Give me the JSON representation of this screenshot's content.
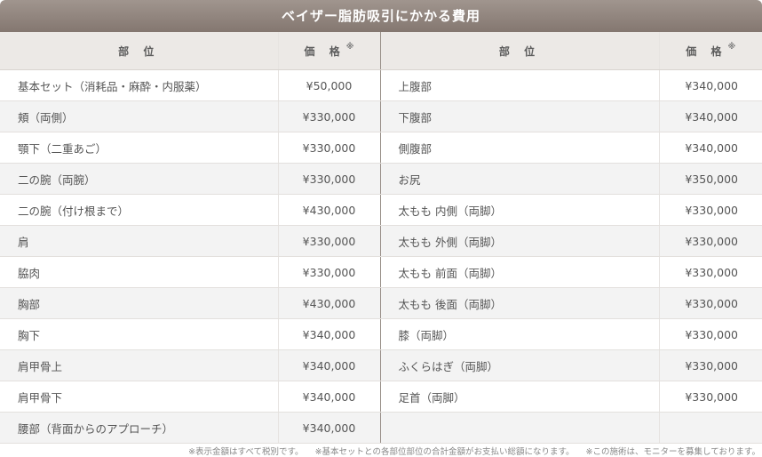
{
  "title": "ベイザー脂肪吸引にかかる費用",
  "headers": {
    "part": "部 位",
    "price": "価 格",
    "price_mark": "※"
  },
  "rows": [
    {
      "left_part": "基本セット（消耗品・麻酔・内服薬）",
      "left_price": "¥50,000",
      "right_part": "上腹部",
      "right_price": "¥340,000"
    },
    {
      "left_part": "頬（両側）",
      "left_price": "¥330,000",
      "right_part": "下腹部",
      "right_price": "¥340,000"
    },
    {
      "left_part": "顎下（二重あご）",
      "left_price": "¥330,000",
      "right_part": "側腹部",
      "right_price": "¥340,000"
    },
    {
      "left_part": "二の腕（両腕）",
      "left_price": "¥330,000",
      "right_part": "お尻",
      "right_price": "¥350,000"
    },
    {
      "left_part": "二の腕（付け根まで）",
      "left_price": "¥430,000",
      "right_part": "太もも 内側（両脚）",
      "right_price": "¥330,000"
    },
    {
      "left_part": "肩",
      "left_price": "¥330,000",
      "right_part": "太もも 外側（両脚）",
      "right_price": "¥330,000"
    },
    {
      "left_part": "脇肉",
      "left_price": "¥330,000",
      "right_part": "太もも 前面（両脚）",
      "right_price": "¥330,000"
    },
    {
      "left_part": "胸部",
      "left_price": "¥430,000",
      "right_part": "太もも 後面（両脚）",
      "right_price": "¥330,000"
    },
    {
      "left_part": "胸下",
      "left_price": "¥340,000",
      "right_part": "膝（両脚）",
      "right_price": "¥330,000"
    },
    {
      "left_part": "肩甲骨上",
      "left_price": "¥340,000",
      "right_part": "ふくらはぎ（両脚）",
      "right_price": "¥330,000"
    },
    {
      "left_part": "肩甲骨下",
      "left_price": "¥340,000",
      "right_part": "足首（両脚）",
      "right_price": "¥330,000"
    },
    {
      "left_part": "腰部（背面からのアプローチ）",
      "left_price": "¥340,000",
      "right_part": "",
      "right_price": ""
    }
  ],
  "footnotes": [
    "※表示金額はすべて税別です。",
    "※基本セットとの各部位部位の合計金額がお支払い総額になります。",
    "※この施術は、モニターを募集しております。"
  ]
}
